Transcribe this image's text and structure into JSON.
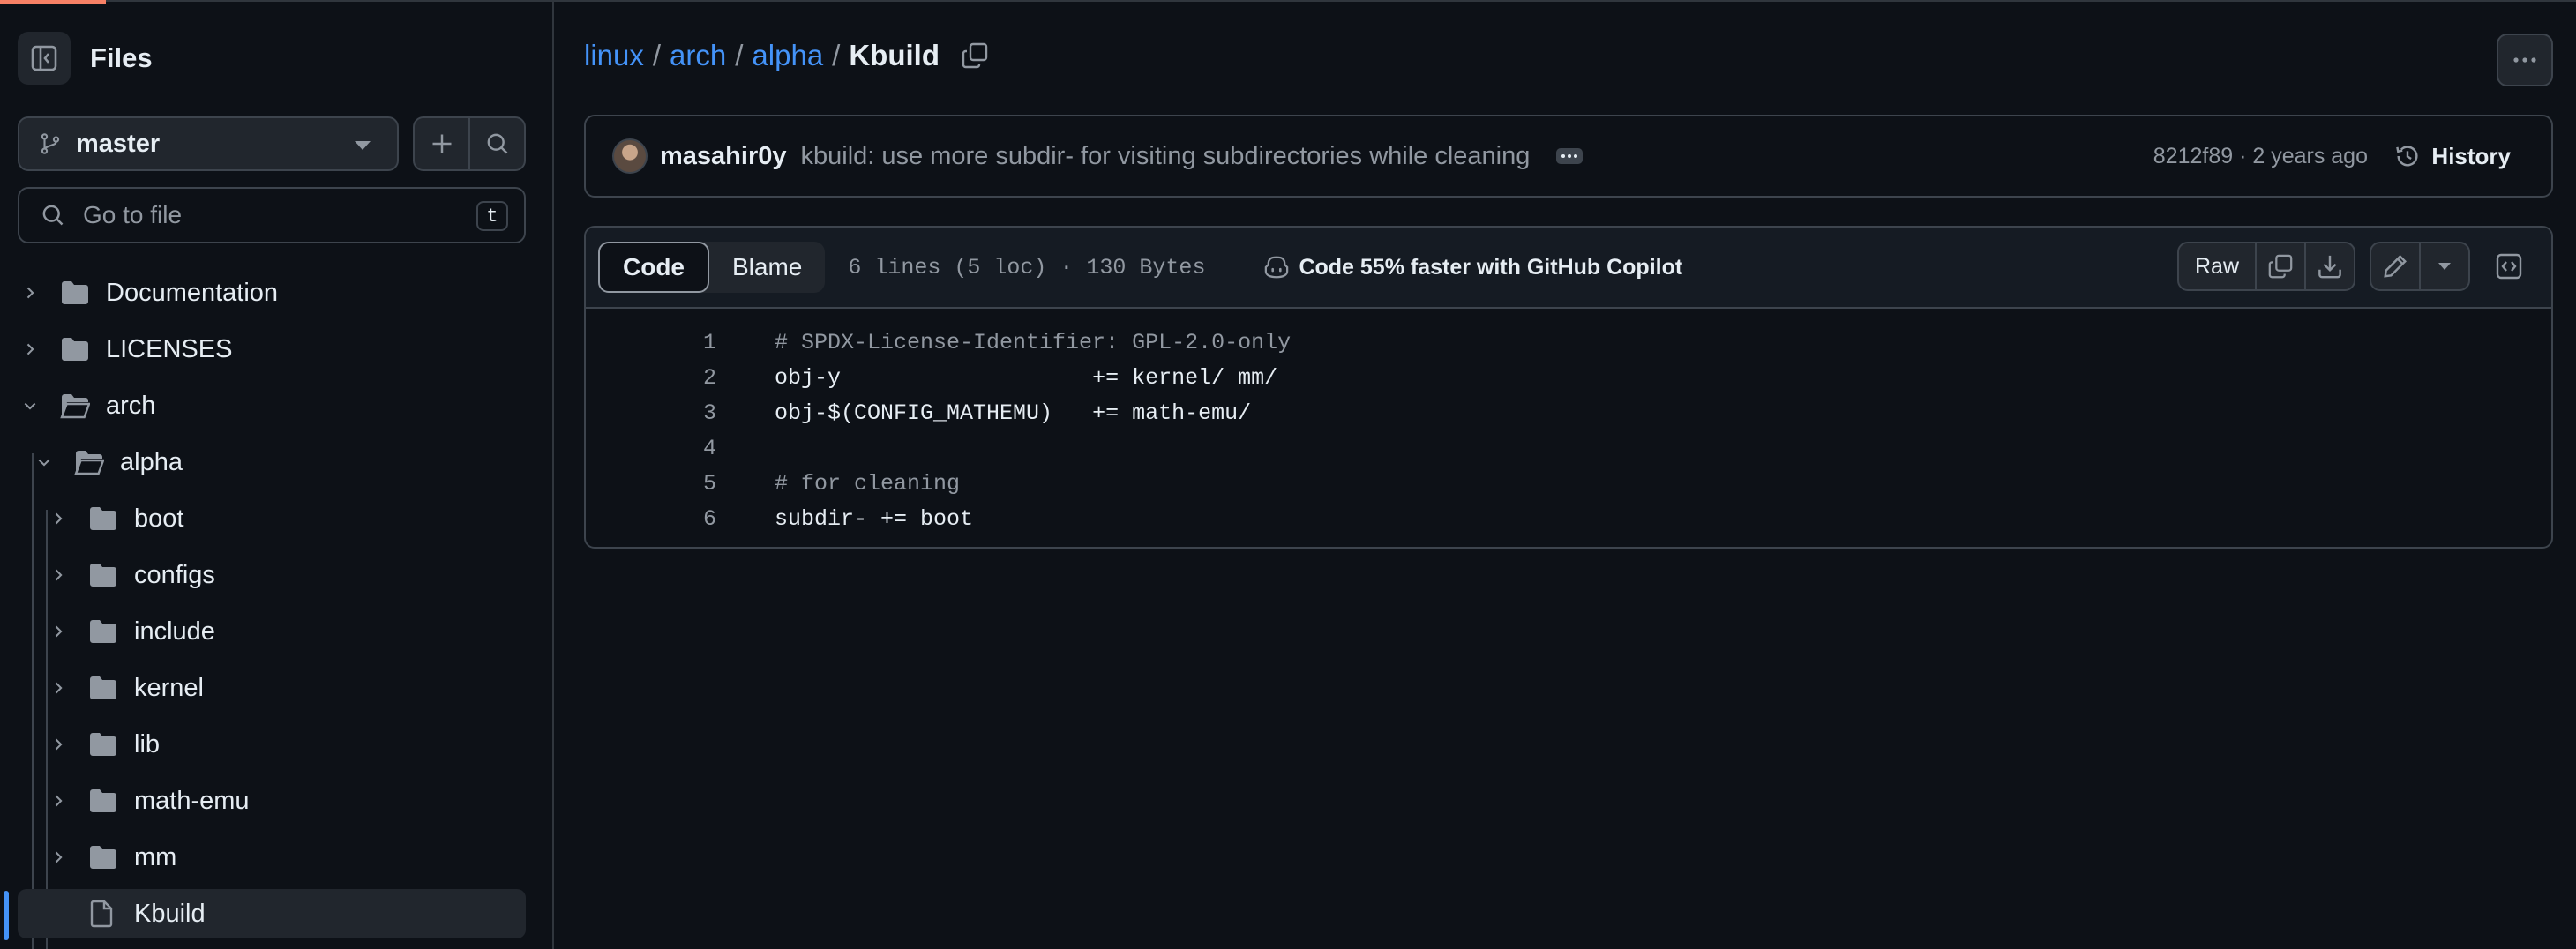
{
  "sidebar": {
    "title": "Files",
    "branch": "master",
    "search_placeholder": "Go to file",
    "search_shortcut": "t",
    "tree": [
      {
        "name": "Documentation",
        "type": "folder",
        "expanded": false,
        "depth": 0
      },
      {
        "name": "LICENSES",
        "type": "folder",
        "expanded": false,
        "depth": 0
      },
      {
        "name": "arch",
        "type": "folder",
        "expanded": true,
        "depth": 0
      },
      {
        "name": "alpha",
        "type": "folder",
        "expanded": true,
        "depth": 1
      },
      {
        "name": "boot",
        "type": "folder",
        "expanded": false,
        "depth": 2
      },
      {
        "name": "configs",
        "type": "folder",
        "expanded": false,
        "depth": 2
      },
      {
        "name": "include",
        "type": "folder",
        "expanded": false,
        "depth": 2
      },
      {
        "name": "kernel",
        "type": "folder",
        "expanded": false,
        "depth": 2
      },
      {
        "name": "lib",
        "type": "folder",
        "expanded": false,
        "depth": 2
      },
      {
        "name": "math-emu",
        "type": "folder",
        "expanded": false,
        "depth": 2
      },
      {
        "name": "mm",
        "type": "folder",
        "expanded": false,
        "depth": 2
      },
      {
        "name": "Kbuild",
        "type": "file",
        "selected": true,
        "depth": 2
      }
    ]
  },
  "breadcrumb": {
    "parts": [
      "linux",
      "arch",
      "alpha"
    ],
    "separator": "/",
    "current": "Kbuild"
  },
  "commit": {
    "author": "masahir0y",
    "message": "kbuild: use more subdir- for visiting subdirectories while cleaning",
    "meta": "8212f89 · 2 years ago",
    "history_label": "History"
  },
  "file": {
    "tabs": [
      "Code",
      "Blame"
    ],
    "active_tab": "Code",
    "info": "6 lines (5 loc) · 130 Bytes",
    "copilot": "Code 55% faster with GitHub Copilot",
    "raw_label": "Raw",
    "lines": [
      {
        "n": "1",
        "text": "# SPDX-License-Identifier: GPL-2.0-only",
        "comment": true
      },
      {
        "n": "2",
        "text": "obj-y\t\t\t+= kernel/ mm/",
        "comment": false
      },
      {
        "n": "3",
        "text": "obj-$(CONFIG_MATHEMU)\t+= math-emu/",
        "comment": false
      },
      {
        "n": "4",
        "text": "",
        "comment": false
      },
      {
        "n": "5",
        "text": "# for cleaning",
        "comment": true
      },
      {
        "n": "6",
        "text": "subdir- += boot",
        "comment": false
      }
    ]
  },
  "colors": {
    "background": "#0d1117",
    "accent_link": "#4493f8",
    "border": "#3d444d",
    "muted_text": "#9198a1",
    "progress_accent": "#f78166"
  }
}
